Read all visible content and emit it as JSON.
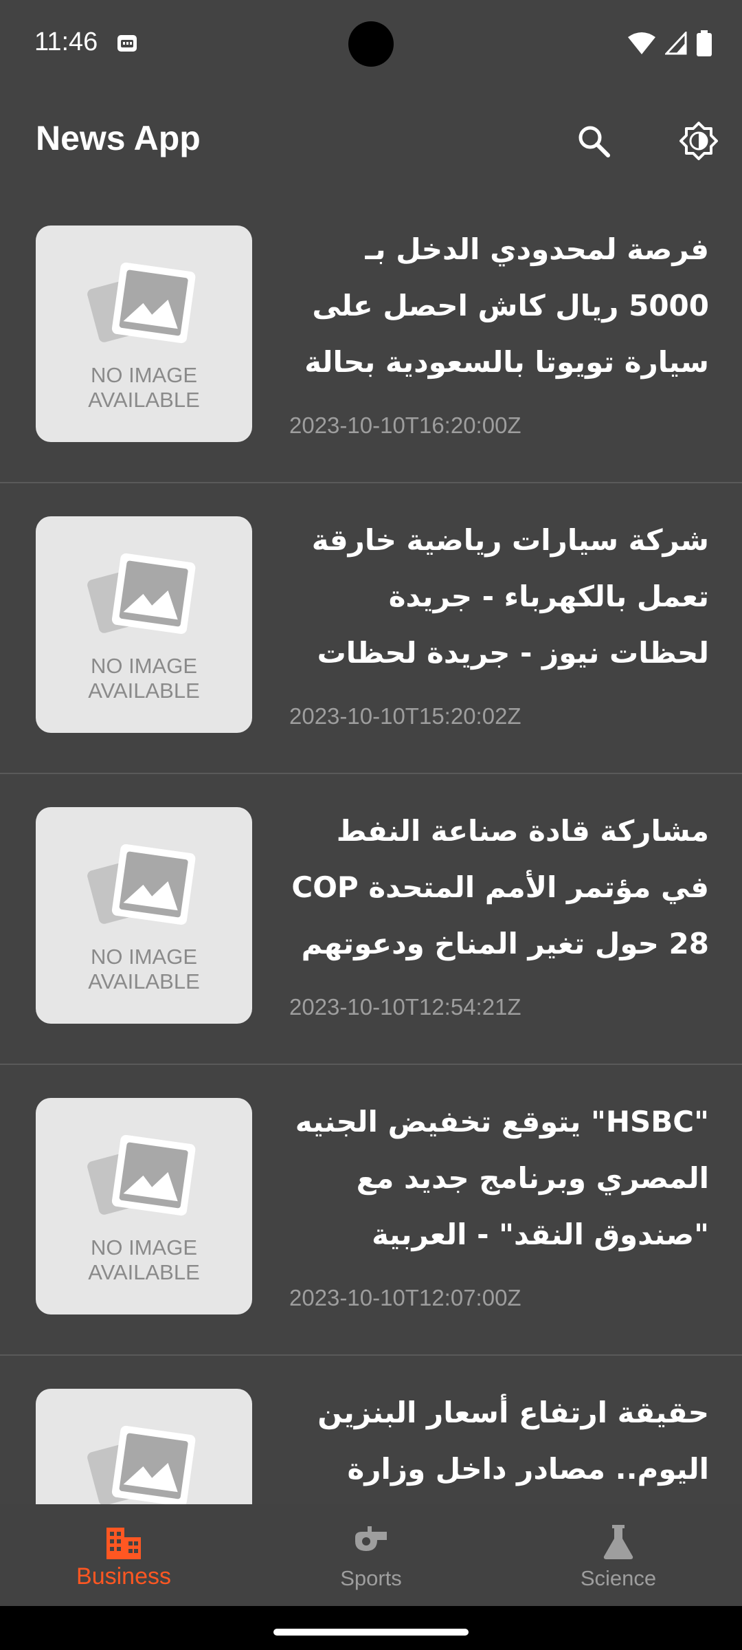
{
  "status": {
    "time": "11:46"
  },
  "app_bar": {
    "title": "News App",
    "actions": [
      "search-icon",
      "theme-toggle-icon"
    ]
  },
  "image_placeholder": {
    "line1": "NO IMAGE",
    "line2": "AVAILABLE"
  },
  "articles": [
    {
      "title": "فرصة لمحدودي الدخل بـ 5000 ريال كاش احصل على سيارة تويوتا بالسعودية بحالة جيدة - …",
      "date": "2023-10-10T16:20:00Z"
    },
    {
      "title": "شركة سيارات رياضية خارقة تعمل بالكهرباء - جريدة لحظات نيوز - جريدة لحظات نيوز",
      "date": "2023-10-10T15:20:02Z"
    },
    {
      "title": "مشاركة قادة صناعة النفط في مؤتمر الأمم المتحدة COP 28 حول تغير المناخ ودعوتهم للتعاو…",
      "date": "2023-10-10T12:54:21Z"
    },
    {
      "title": "\"HSBC\" يتوقع تخفيض الجنيه المصري وبرنامج جديد مع \"صندوق النقد\" - العربية",
      "date": "2023-10-10T12:07:00Z"
    },
    {
      "title": "حقيقة ارتفاع أسعار البنزين اليوم.. مصادر داخل وزارة البترول تكشف",
      "date": ""
    }
  ],
  "bottom_nav": {
    "items": [
      {
        "label": "Business",
        "icon": "building-icon",
        "selected": true
      },
      {
        "label": "Sports",
        "icon": "whistle-icon",
        "selected": false
      },
      {
        "label": "Science",
        "icon": "flask-icon",
        "selected": false
      }
    ]
  },
  "colors": {
    "background": "#434343",
    "accent": "#ff5722",
    "inactive": "#9e9e9e",
    "date": "#9e9e9e"
  }
}
